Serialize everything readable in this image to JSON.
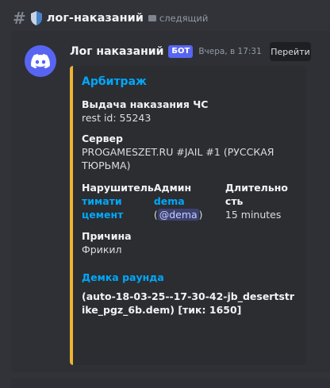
{
  "channel": {
    "hash_symbol": "#",
    "name": "лог-наказаний",
    "follow_label": "следящий"
  },
  "message": {
    "author": "Лог наказаний",
    "bot_tag": "БОТ",
    "timestamp": "Вчера, в 17:31",
    "jump_label": "Перейти"
  },
  "embed": {
    "accent_color": "#f0b232",
    "title": "Арбитраж",
    "fields": {
      "action_name": "Выдача наказания ЧС",
      "action_value": "rest id: 55243",
      "server_name": "Сервер",
      "server_value": "PROGAMESZET.RU #JAIL #1 (РУССКАЯ ТЮРЬМА)",
      "violator_name": "Нарушитель",
      "violator_value": "тимати цемент",
      "admin_name": "Админ",
      "admin_value": "dema",
      "admin_open": "(",
      "admin_mention": "@dema",
      "admin_close": ")",
      "duration_name": "Длительность",
      "duration_value": "15 minutes",
      "reason_name": "Причина",
      "reason_value": "Фрикил"
    },
    "demo": {
      "title": "Демка раунда",
      "value": "(auto-18-03-25--17-30-42-jb_desertstrike_pgz_6b.dem) [тик: 1650]"
    }
  }
}
